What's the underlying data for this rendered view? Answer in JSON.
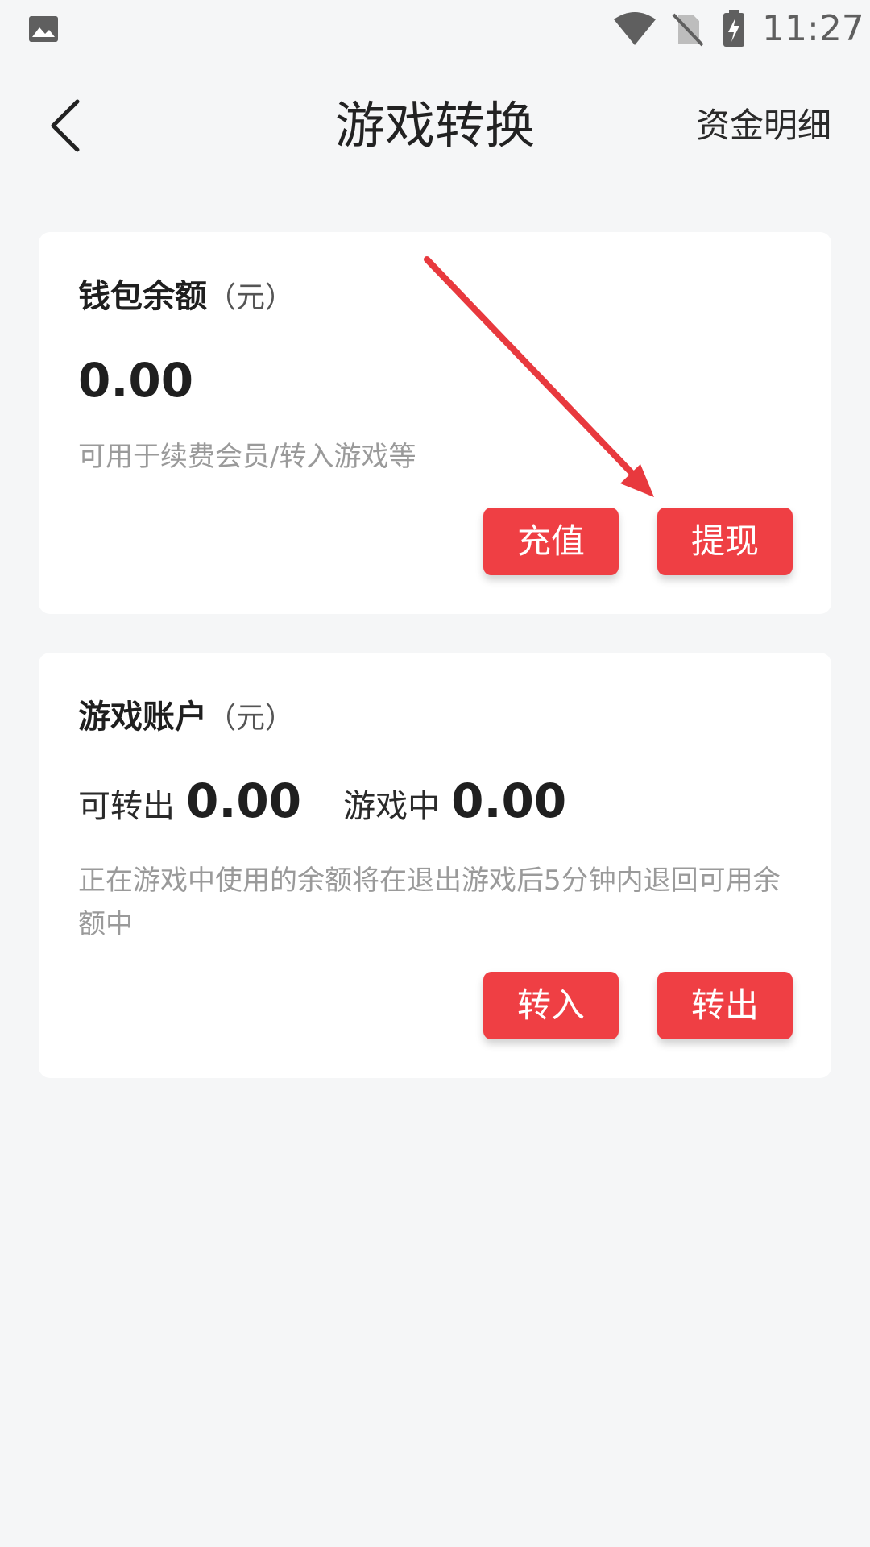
{
  "status_bar": {
    "time": "11:27",
    "left_icon": "gallery-icon",
    "right_icons": [
      "wifi-icon",
      "no-sim-icon",
      "battery-charging-icon"
    ]
  },
  "header": {
    "back_icon": "chevron-left-icon",
    "title": "游戏转换",
    "action_label": "资金明细"
  },
  "wallet_card": {
    "title": "钱包余额",
    "unit": "（元）",
    "amount": "0.00",
    "note": "可用于续费会员/转入游戏等",
    "buttons": {
      "recharge": "充值",
      "withdraw": "提现"
    }
  },
  "game_card": {
    "title": "游戏账户",
    "unit": "（元）",
    "transferable_label": "可转出",
    "transferable_value": "0.00",
    "in_game_label": "游戏中",
    "in_game_value": "0.00",
    "note": "正在游戏中使用的余额将在退出游戏后5分钟内退回可用余额中",
    "buttons": {
      "transfer_in": "转入",
      "transfer_out": "转出"
    }
  },
  "colors": {
    "accent": "#ef3f44",
    "background": "#f5f6f7",
    "card": "#ffffff",
    "muted_text": "#9a9a9a",
    "annotation": "#e8393e"
  }
}
